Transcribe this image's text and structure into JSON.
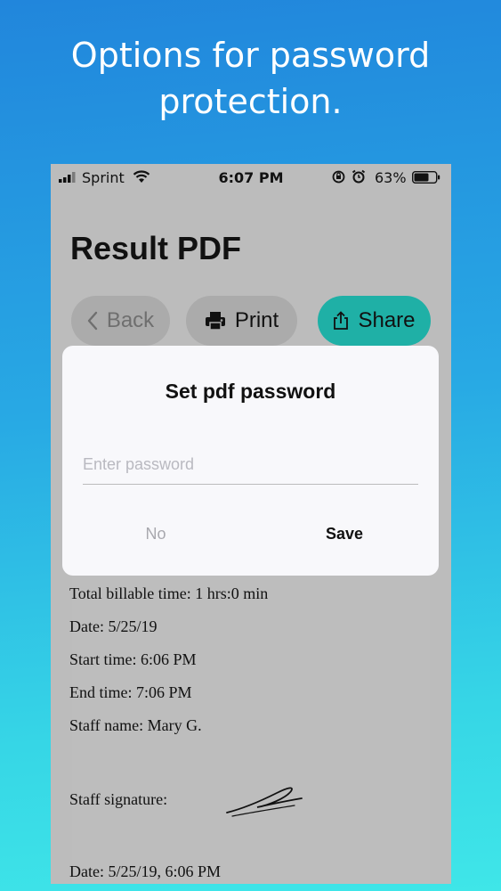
{
  "promo": {
    "headline_line1": "Options for password",
    "headline_line2": "protection."
  },
  "status_bar": {
    "carrier": "Sprint",
    "time": "6:07 PM",
    "battery_percent": "63%"
  },
  "page": {
    "title": "Result PDF"
  },
  "toolbar": {
    "back_label": "Back",
    "print_label": "Print",
    "share_label": "Share"
  },
  "colors": {
    "share_accent": "#1fb0a6",
    "background_top": "#2186dc",
    "background_bottom": "#3fe6e8"
  },
  "document": {
    "lines": [
      "Total billable time: 1 hrs:0 min",
      "Date: 5/25/19",
      "Start time: 6:06 PM",
      "End time: 7:06 PM",
      "Staff name: Mary G.",
      "Staff signature:",
      "Date: 5/25/19, 6:06 PM"
    ]
  },
  "dialog": {
    "title": "Set pdf password",
    "input_placeholder": "Enter password",
    "input_value": "",
    "no_label": "No",
    "save_label": "Save"
  }
}
